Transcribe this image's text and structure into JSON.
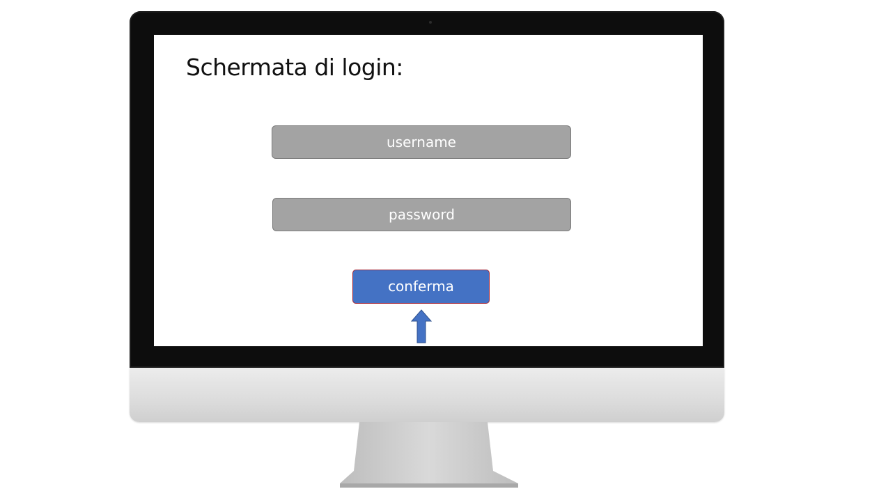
{
  "screen": {
    "title": "Schermata di login:",
    "username_placeholder": "username",
    "password_placeholder": "password",
    "confirm_label": "conferma"
  },
  "colors": {
    "field_background": "#a3a3a3",
    "button_background": "#4472c4",
    "button_border": "#a52a3a",
    "arrow": "#4472c4"
  },
  "icons": {
    "pointer": "arrow-up-icon"
  }
}
